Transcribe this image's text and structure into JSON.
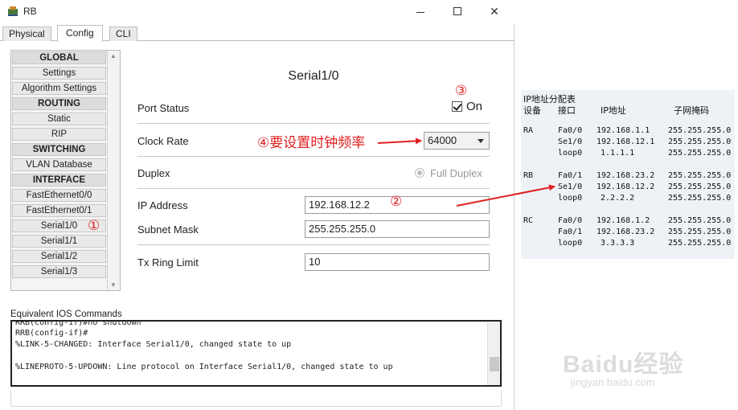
{
  "window": {
    "title": "RB"
  },
  "tabs": [
    "Physical",
    "Config",
    "CLI"
  ],
  "nav": {
    "items": [
      {
        "label": "GLOBAL",
        "header": true
      },
      {
        "label": "Settings"
      },
      {
        "label": "Algorithm Settings"
      },
      {
        "label": "ROUTING",
        "header": true
      },
      {
        "label": "Static"
      },
      {
        "label": "RIP"
      },
      {
        "label": "SWITCHING",
        "header": true
      },
      {
        "label": "VLAN Database"
      },
      {
        "label": "INTERFACE",
        "header": true
      },
      {
        "label": "FastEthernet0/0"
      },
      {
        "label": "FastEthernet0/1"
      },
      {
        "label": "Serial1/0"
      },
      {
        "label": "Serial1/1"
      },
      {
        "label": "Serial1/2"
      },
      {
        "label": "Serial1/3"
      }
    ]
  },
  "panel": {
    "title": "Serial1/0",
    "port_status_label": "Port Status",
    "port_status_value": "On",
    "clock_rate_label": "Clock Rate",
    "clock_rate_value": "64000",
    "duplex_label": "Duplex",
    "duplex_value": "Full Duplex",
    "ip_label": "IP Address",
    "ip_value": "192.168.12.2",
    "mask_label": "Subnet Mask",
    "mask_value": "255.255.255.0",
    "tx_label": "Tx Ring Limit",
    "tx_value": "10"
  },
  "annotations": {
    "a1": "①",
    "a2": "②",
    "a3": "③",
    "a4": "④要设置时钟频率"
  },
  "ios": {
    "label": "Equivalent IOS Commands",
    "lines": [
      "RRB(config-if)#no shutdown",
      "RRB(config-if)#",
      "%LINK-5-CHANGED: Interface Serial1/0, changed state to up",
      "",
      "%LINEPROTO-5-UPDOWN: Line protocol on Interface Serial1/0, changed state to up"
    ]
  },
  "ip_table": {
    "title": "IP地址分配表",
    "headers": [
      "设备",
      "接口",
      "IP地址",
      "子网掩码"
    ],
    "rows": [
      [
        "RA",
        "Fa0/0",
        "192.168.1.1",
        "255.255.255.0"
      ],
      [
        "",
        "Se1/0",
        "192.168.12.1",
        "255.255.255.0"
      ],
      [
        "",
        "loop0",
        "1.1.1.1",
        "255.255.255.0"
      ],
      [
        "RB",
        "Fa0/1",
        "192.168.23.2",
        "255.255.255.0"
      ],
      [
        "",
        "Se1/0",
        "192.168.12.2",
        "255.255.255.0"
      ],
      [
        "",
        "loop0",
        "2.2.2.2",
        "255.255.255.0"
      ],
      [
        "RC",
        "Fa0/0",
        "192.168.1.2",
        "255.255.255.0"
      ],
      [
        "",
        "Fa0/1",
        "192.168.23.2",
        "255.255.255.0"
      ],
      [
        "",
        "loop0",
        "3.3.3.3",
        "255.255.255.0"
      ]
    ]
  },
  "watermark": {
    "main": "Baidu经验",
    "sub": "jingyan.baidu.com"
  },
  "colors": {
    "annotation": "#e02020"
  }
}
